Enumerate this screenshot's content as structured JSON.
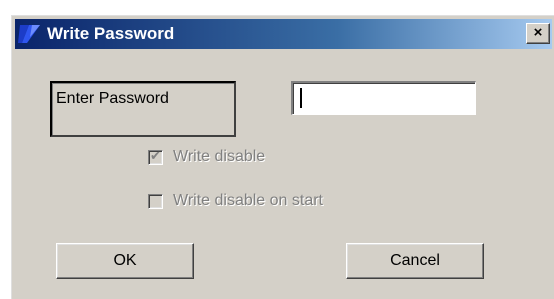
{
  "window": {
    "title": "Write Password",
    "close_label": "×"
  },
  "form": {
    "password_label": "Enter Password",
    "password_value": "",
    "write_disable": {
      "label": "Write disable",
      "checked": true,
      "enabled": false
    },
    "write_disable_on_start": {
      "label": "Write disable on start",
      "checked": false,
      "enabled": false
    }
  },
  "buttons": {
    "ok_label": "OK",
    "cancel_label": "Cancel"
  },
  "colors": {
    "titlebar_start": "#0a246a",
    "titlebar_end": "#a6caf0",
    "face": "#d4d0c8",
    "disabled_text": "#808080"
  },
  "icons": {
    "title": "app-logo-icon",
    "close": "close-icon",
    "checkmark": "checkmark-icon"
  }
}
